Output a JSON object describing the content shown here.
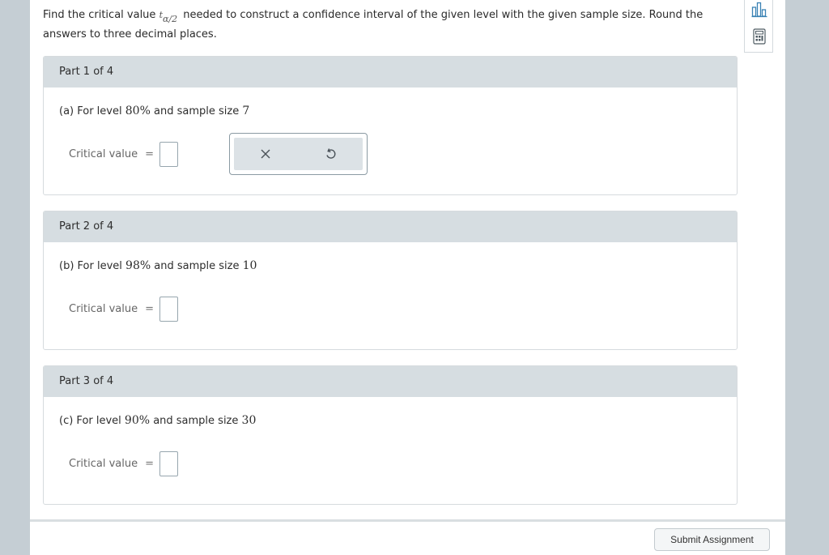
{
  "intro": {
    "lead": "Find the critical value",
    "symbol": "t",
    "subscript": "α/2",
    "rest": "needed to construct a confidence interval of the given level with the given sample size. Round the answers to three decimal places."
  },
  "tools": [
    {
      "icon": "bar-chart-icon"
    },
    {
      "icon": "calculator-icon"
    }
  ],
  "parts": [
    {
      "header": "Part 1 of 4",
      "prefix": "(a) For level",
      "level": "80%",
      "mid": "and sample size",
      "size": "7",
      "cv_label": "Critical value",
      "equals": "=",
      "value": ""
    },
    {
      "header": "Part 2 of 4",
      "prefix": "(b) For level",
      "level": "98%",
      "mid": "and sample size",
      "size": "10",
      "cv_label": "Critical value",
      "equals": "=",
      "value": ""
    },
    {
      "header": "Part 3 of 4",
      "prefix": "(c) For level",
      "level": "90%",
      "mid": "and sample size",
      "size": "30",
      "cv_label": "Critical value",
      "equals": "=",
      "value": ""
    }
  ],
  "keypad": {
    "clear_icon": "close-icon",
    "undo_icon": "undo-icon"
  },
  "footer": {
    "submit_label": "Submit Assignment"
  }
}
